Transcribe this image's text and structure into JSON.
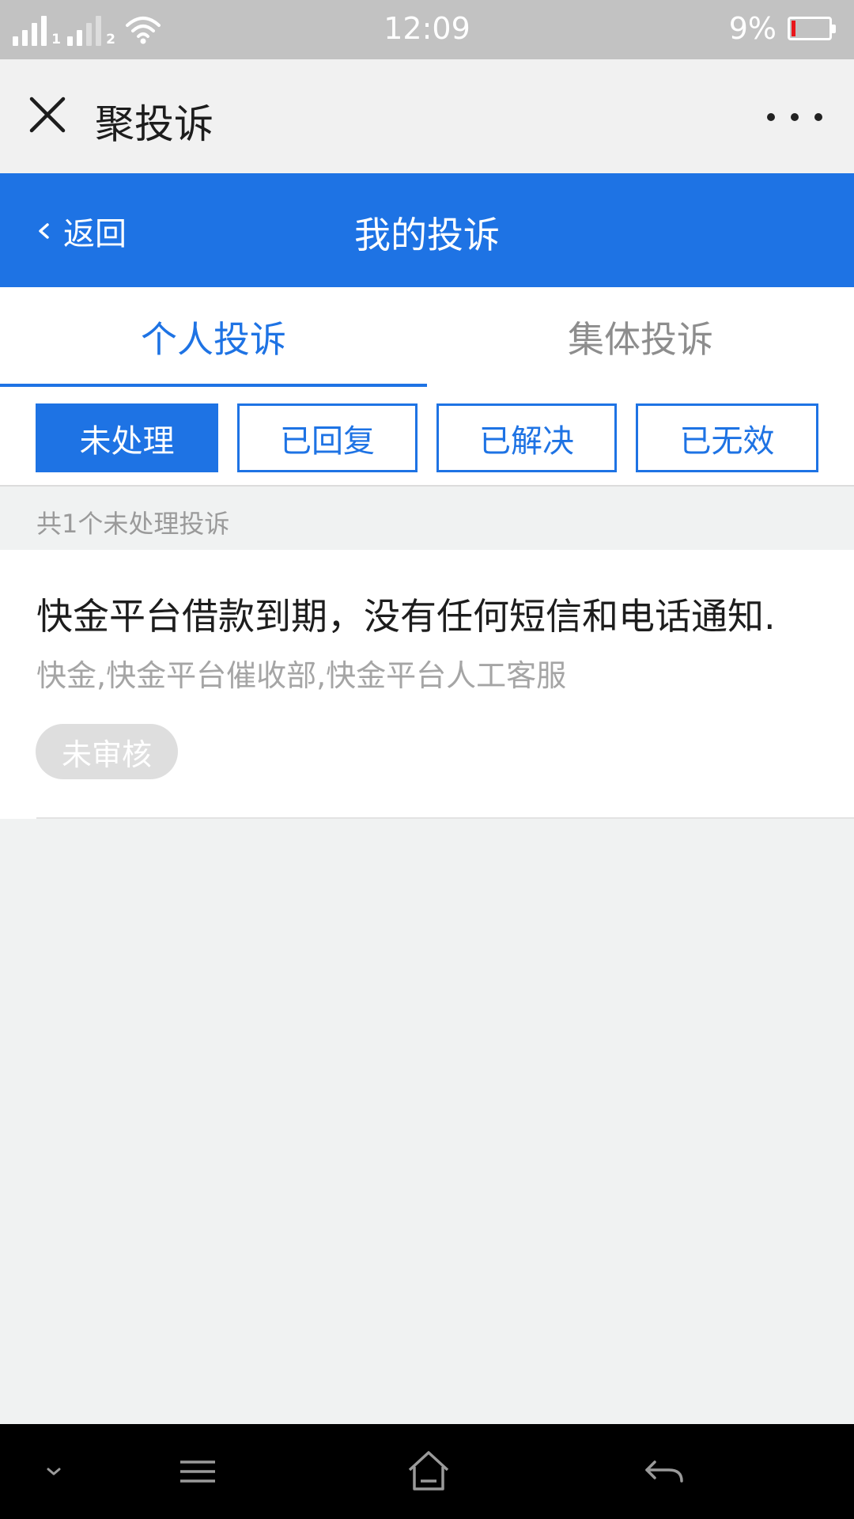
{
  "status_bar": {
    "sim1": "1",
    "sim2": "2",
    "time": "12:09",
    "battery_percent": "9%",
    "battery_level": 0.09,
    "icons": [
      "signal-icon",
      "wifi-icon",
      "battery-icon"
    ]
  },
  "app_bar": {
    "title": "聚投诉",
    "close_icon": "close-icon",
    "more_icon": "more-icon"
  },
  "header": {
    "back_label": "返回",
    "title": "我的投诉"
  },
  "tabs": [
    {
      "label": "个人投诉",
      "active": true
    },
    {
      "label": "集体投诉",
      "active": false
    }
  ],
  "filters": [
    {
      "label": "未处理",
      "active": true
    },
    {
      "label": "已回复",
      "active": false
    },
    {
      "label": "已解决",
      "active": false
    },
    {
      "label": "已无效",
      "active": false
    }
  ],
  "summary": {
    "count_text": "共1个未处理投诉"
  },
  "complaints": [
    {
      "title": "快金平台借款到期，没有任何短信和电话通知.",
      "targets": "快金,快金平台催收部,快金平台人工客服",
      "status": "未审核"
    }
  ],
  "colors": {
    "primary": "#1e73e4",
    "status_bar": "#c2c2c2",
    "badge_bg": "#dedede",
    "battery_low": "#e8161b"
  },
  "nav_bar": {
    "icons": [
      "chevron-down-icon",
      "menu-icon",
      "home-icon",
      "back-arrow-icon"
    ]
  }
}
